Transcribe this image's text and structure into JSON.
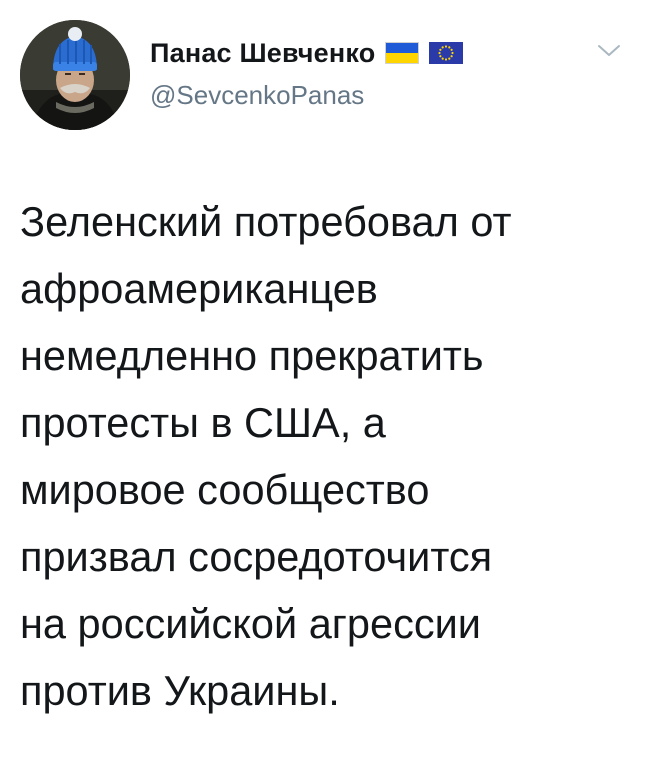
{
  "author": {
    "display_name": "Панас Шевченко",
    "handle": "@SevcenkoPanas",
    "badges": [
      "ukraine-flag-icon",
      "eu-flag-icon"
    ]
  },
  "tweet": {
    "lines": [
      "Зеленский потребовал от",
      "афроамериканцев",
      "немедленно прекратить",
      "протесты в США, а",
      "мировое сообщество",
      "призвал сосредоточится",
      "на российской агрессии",
      "против Украины."
    ]
  },
  "colors": {
    "text": "#14171a",
    "secondary_text": "#657786",
    "chevron": "#aab8c2",
    "ukraine_blue": "#1f5bd6",
    "ukraine_yellow": "#ffd500",
    "eu_blue": "#2a3aa8",
    "eu_stars": "#ffd500"
  },
  "icons": {
    "menu": "chevron-down-icon",
    "avatar": "avatar"
  }
}
